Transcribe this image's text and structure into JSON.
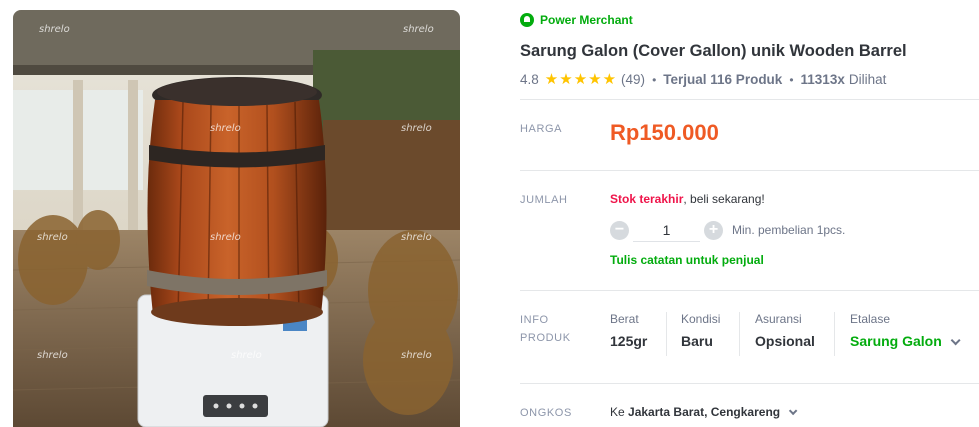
{
  "photo": {
    "alt": "Sarung Galon wooden barrel cover on water dispenser",
    "watermark": "shrelo"
  },
  "merchant": {
    "badge_label": "Power Merchant",
    "icon": "power-merchant-badge-icon",
    "color": "#03ac0e"
  },
  "product": {
    "title": "Sarung Galon (Cover Gallon) unik Wooden Barrel",
    "rating": "4.8",
    "stars": 5,
    "review_count": "(49)",
    "sold": "Terjual 116 Produk",
    "views": "11313x",
    "views_suffix": "Dilihat"
  },
  "price": {
    "label": "HARGA",
    "value": "Rp150.000",
    "color": "#ef5a24"
  },
  "quantity": {
    "label": "JUMLAH",
    "stock_warning": "Stok terakhir",
    "stock_rest": ", beli sekarang!",
    "value": "1",
    "minus_label": "−",
    "plus_label": "+",
    "min_text": "Min. pembelian 1pcs.",
    "note_link": "Tulis catatan untuk penjual"
  },
  "info": {
    "label_line1": "INFO",
    "label_line2": "PRODUK",
    "berat_key": "Berat",
    "berat_val": "125gr",
    "kondisi_key": "Kondisi",
    "kondisi_val": "Baru",
    "asuransi_key": "Asuransi",
    "asuransi_val": "Opsional",
    "etalase_key": "Etalase",
    "etalase_val": "Sarung Galon"
  },
  "shipping": {
    "label": "ONGKOS",
    "prefix": "Ke",
    "destination": "Jakarta Barat, Cengkareng"
  },
  "colors": {
    "accent_green": "#03ac0e",
    "star": "#ffc400",
    "warning_red": "#ef144a"
  }
}
